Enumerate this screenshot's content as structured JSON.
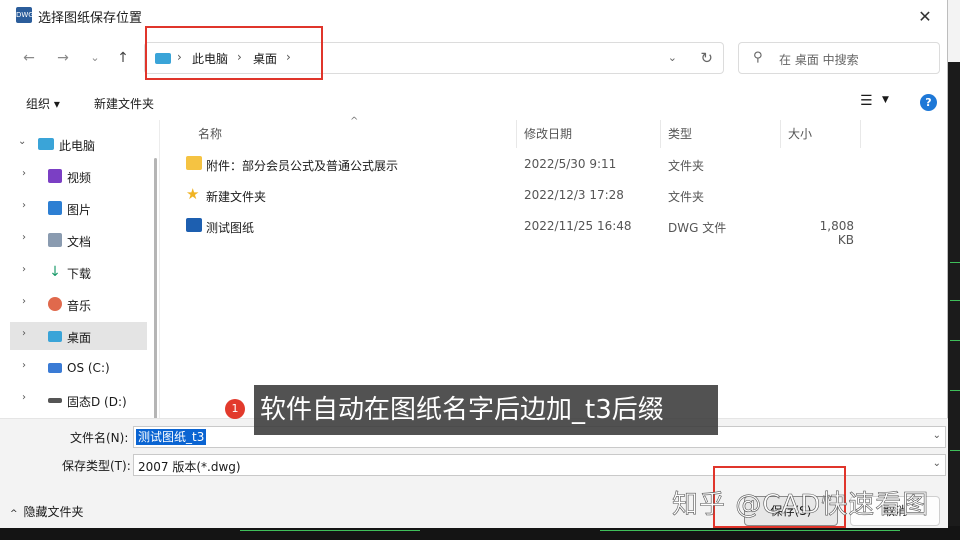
{
  "window": {
    "title": "选择图纸保存位置",
    "icon_text": "DWG",
    "close": "✕"
  },
  "nav": {
    "back": "←",
    "forward": "→",
    "recent": "⌄",
    "up": "↑",
    "address": [
      "此电脑",
      "桌面"
    ],
    "address_sep": "›",
    "dropdown": "⌄",
    "refresh": "↻",
    "search_placeholder": "在 桌面 中搜索"
  },
  "commands": {
    "organize": "组织 ▾",
    "new_folder": "新建文件夹",
    "view": "☰",
    "view_drop": "▼",
    "help": "?"
  },
  "sidebar": {
    "root": {
      "label": "此电脑",
      "chev": "⌄"
    },
    "items": [
      {
        "label": "视频",
        "chev": "›",
        "color": "#7b3fc4"
      },
      {
        "label": "图片",
        "chev": "›",
        "color": "#2d7fd3"
      },
      {
        "label": "文档",
        "chev": "›",
        "color": "#8a9bb0"
      },
      {
        "label": "下载",
        "chev": "›",
        "color": "#1a9a6a"
      },
      {
        "label": "音乐",
        "chev": "›",
        "color": "#e0694c"
      },
      {
        "label": "桌面",
        "chev": "›",
        "color": "#3aa4d8",
        "selected": true
      },
      {
        "label": "OS (C:)",
        "chev": "›",
        "color": "#3a7bd5"
      },
      {
        "label": "固态D (D:)",
        "chev": "›",
        "color": "#555555"
      }
    ]
  },
  "columns": {
    "name": "名称",
    "date": "修改日期",
    "type": "类型",
    "size": "大小",
    "sort": "^"
  },
  "files": [
    {
      "name": "附件：部分会员公式及普通公式展示",
      "date": "2022/5/30 9:11",
      "type": "文件夹",
      "size": "",
      "icon": "folder-icon"
    },
    {
      "name": "新建文件夹",
      "date": "2022/12/3 17:28",
      "type": "文件夹",
      "size": "",
      "icon": "star-icon"
    },
    {
      "name": "测试图纸",
      "date": "2022/11/25 16:48",
      "type": "DWG 文件",
      "size": "1,808 KB",
      "icon": "cad-file-icon"
    }
  ],
  "annotation": {
    "badge": "1",
    "text": "软件自动在图纸名字后边加_t3后缀"
  },
  "form": {
    "filename_label": "文件名(N):",
    "filename_value": "测试图纸_t3",
    "filetype_label": "保存类型(T):",
    "filetype_value": "2007 版本(*.dwg)",
    "dropdown": "⌄",
    "hide_folders": "隐藏文件夹",
    "hide_chev": "^",
    "save": "保存(S)",
    "cancel": "取消"
  },
  "watermark": "知乎 @CAD快速看图",
  "colors": {
    "highlight": "#e0352b",
    "selection": "#0a64d2",
    "accent": "#1e78d7"
  }
}
